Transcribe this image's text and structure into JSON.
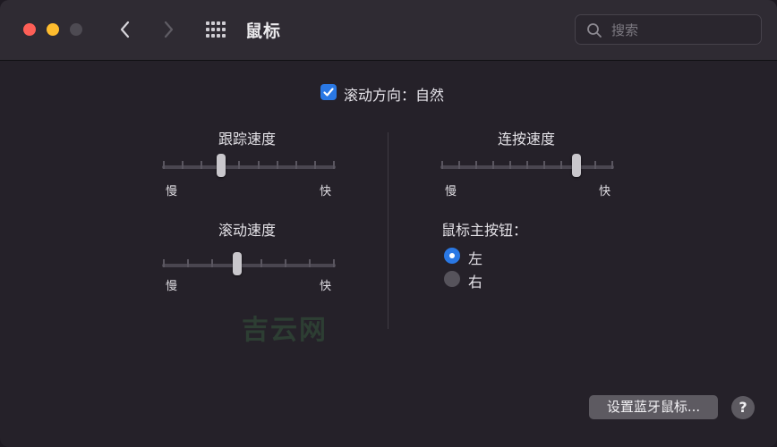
{
  "window": {
    "title": "鼠标",
    "search": {
      "placeholder": "搜索",
      "value": ""
    }
  },
  "icons": {
    "close": "close-button-red",
    "minimize": "minimize-button-yellow",
    "zoom": "zoom-button-disabled",
    "back": "chevron-left-icon",
    "forward": "chevron-right-icon",
    "grid": "grid-icon",
    "search": "magnifying-glass-icon"
  },
  "scroll_direction": {
    "label": "滚动方向：自然",
    "checked": true
  },
  "tracking_speed": {
    "title": "跟踪速度",
    "min_label": "慢",
    "max_label": "快",
    "ticks": 10,
    "value": 0.33
  },
  "scroll_speed": {
    "title": "滚动速度",
    "min_label": "慢",
    "max_label": "快",
    "ticks": 8,
    "value": 0.43
  },
  "double_click_speed": {
    "title": "连按速度",
    "min_label": "慢",
    "max_label": "快",
    "ticks": 11,
    "value": 0.8
  },
  "primary_button": {
    "title": "鼠标主按钮：",
    "options": [
      {
        "label": "左",
        "selected": true
      },
      {
        "label": "右",
        "selected": false
      }
    ]
  },
  "watermark": "吉云网",
  "bluetooth_button": "设置蓝牙鼠标...",
  "help_button": "?",
  "colors": {
    "accent": "#2a78e4",
    "background": "#252129",
    "titlebar": "#2f2b33"
  }
}
